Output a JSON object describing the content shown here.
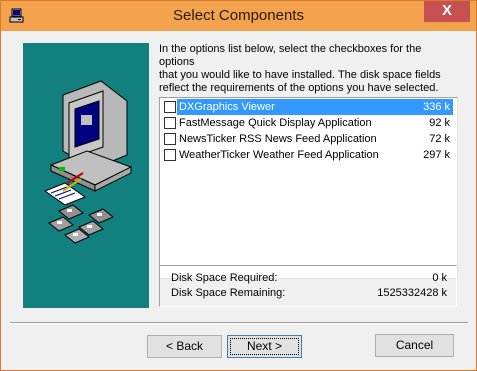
{
  "window": {
    "title": "Select Components",
    "close_glyph": "X"
  },
  "instructions": {
    "line1": "In the options list below, select the checkboxes for the options",
    "line2": "that you would like to have installed.  The disk space fields",
    "line3": "reflect the requirements of the options you have selected."
  },
  "components": [
    {
      "label": "DXGraphics Viewer",
      "size": "336 k",
      "checked": false,
      "selected": true
    },
    {
      "label": "FastMessage Quick Display Application",
      "size": "92 k",
      "checked": false,
      "selected": false
    },
    {
      "label": "NewsTicker RSS News Feed Application",
      "size": "72 k",
      "checked": false,
      "selected": false
    },
    {
      "label": "WeatherTicker Weather Feed Application",
      "size": "297 k",
      "checked": false,
      "selected": false
    }
  ],
  "disk": {
    "required_label": "Disk Space Required:",
    "required_value": "0 k",
    "remaining_label": "Disk Space Remaining:",
    "remaining_value": "1525332428 k"
  },
  "buttons": {
    "back": "< Back",
    "next": "Next >",
    "cancel": "Cancel"
  },
  "colors": {
    "titlebar": "#f3a24e",
    "graphic_bg": "#138080",
    "selection": "#3399ff",
    "close": "#c75050"
  },
  "icons": [
    "installer-app-icon",
    "computer-monitor-icon",
    "documents-icon",
    "floppy-disks-icon"
  ]
}
